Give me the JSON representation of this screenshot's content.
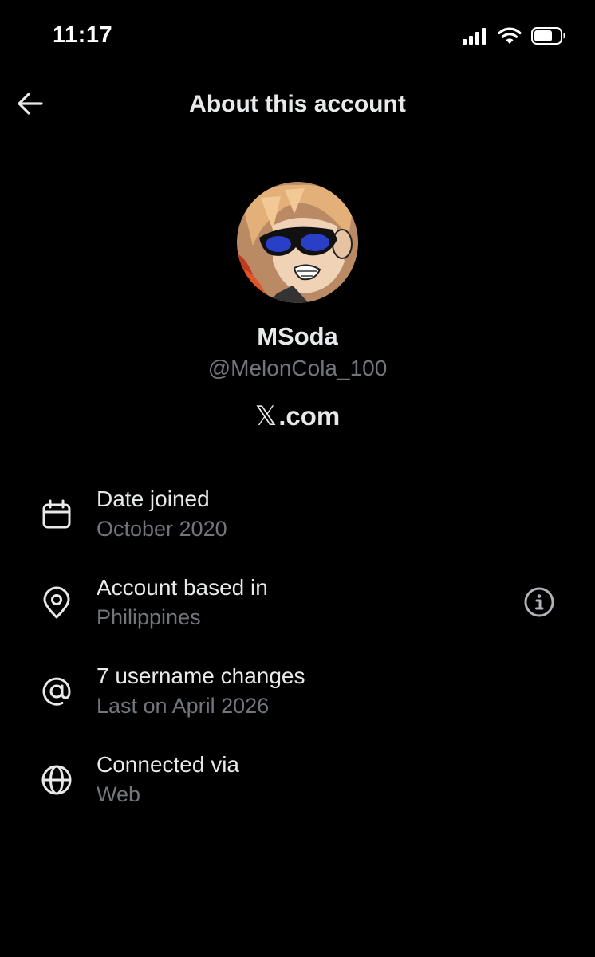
{
  "status_bar": {
    "time": "11:17"
  },
  "header": {
    "title": "About this account"
  },
  "profile": {
    "display_name": "MSoda",
    "handle": "@MelonCola_100",
    "platform_logo": "𝕏",
    "platform_suffix": ".com"
  },
  "details": [
    {
      "icon": "calendar-icon",
      "title": "Date joined",
      "value": "October 2020"
    },
    {
      "icon": "location-pin-icon",
      "title": "Account based in",
      "value": "Philippines"
    },
    {
      "icon": "at-sign-icon",
      "title": "7 username changes",
      "value": "Last on April 2026"
    },
    {
      "icon": "globe-icon",
      "title": "Connected via",
      "value": "Web"
    }
  ],
  "colors": {
    "background": "#000000",
    "primary_text": "#e7e9ea",
    "secondary_text": "#71767b"
  }
}
